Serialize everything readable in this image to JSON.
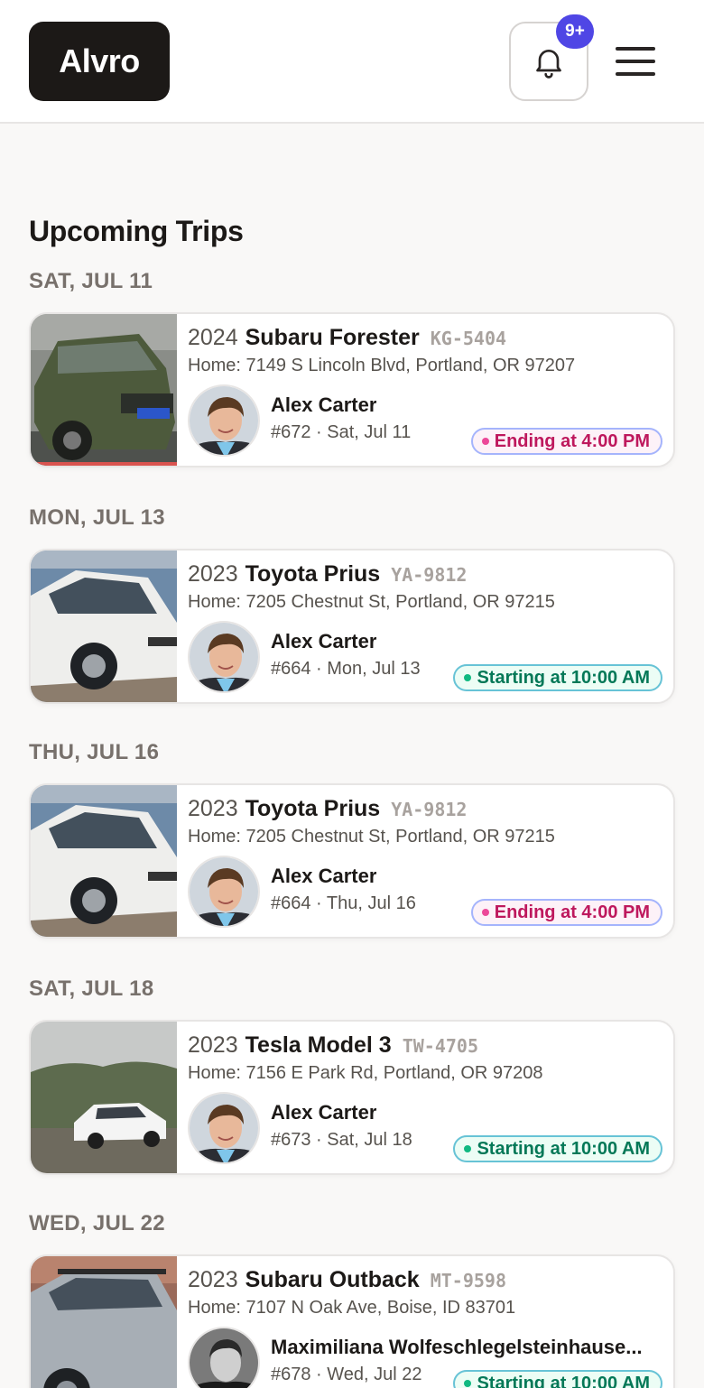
{
  "header": {
    "logo": "Alvro",
    "notification_badge": "9+"
  },
  "page_title": "Upcoming Trips",
  "colors": {
    "brand_dark": "#1c1917",
    "badge": "#4f46e5",
    "ending": "#be185d",
    "starting": "#047857"
  },
  "trips": [
    {
      "day": "SAT, JUL 11",
      "year": "2024",
      "model": "Subaru Forester",
      "plate": "KG-5404",
      "address": "Home: 7149 S Lincoln Blvd, Portland, OR 97207",
      "renter": "Alex Carter",
      "meta": "#672 · Sat, Jul 11",
      "status": "Ending at 4:00 PM",
      "status_type": "ending"
    },
    {
      "day": "MON, JUL 13",
      "year": "2023",
      "model": "Toyota Prius",
      "plate": "YA-9812",
      "address": "Home: 7205 Chestnut St, Portland, OR 97215",
      "renter": "Alex Carter",
      "meta": "#664 · Mon, Jul 13",
      "status": "Starting at 10:00 AM",
      "status_type": "starting"
    },
    {
      "day": "THU, JUL 16",
      "year": "2023",
      "model": "Toyota Prius",
      "plate": "YA-9812",
      "address": "Home: 7205 Chestnut St, Portland, OR 97215",
      "renter": "Alex Carter",
      "meta": "#664 · Thu, Jul 16",
      "status": "Ending at 4:00 PM",
      "status_type": "ending"
    },
    {
      "day": "SAT, JUL 18",
      "year": "2023",
      "model": "Tesla Model 3",
      "plate": "TW-4705",
      "address": "Home: 7156 E Park Rd, Portland, OR 97208",
      "renter": "Alex Carter",
      "meta": "#673 · Sat, Jul 18",
      "status": "Starting at 10:00 AM",
      "status_type": "starting"
    },
    {
      "day": "WED, JUL 22",
      "year": "2023",
      "model": "Subaru Outback",
      "plate": "MT-9598",
      "address": "Home: 7107 N Oak Ave, Boise, ID 83701",
      "renter": "Maximiliana Wolfeschlegelsteinhause...",
      "meta": "#678 · Wed, Jul 22",
      "status": "Starting at 10:00 AM",
      "status_type": "starting"
    }
  ]
}
